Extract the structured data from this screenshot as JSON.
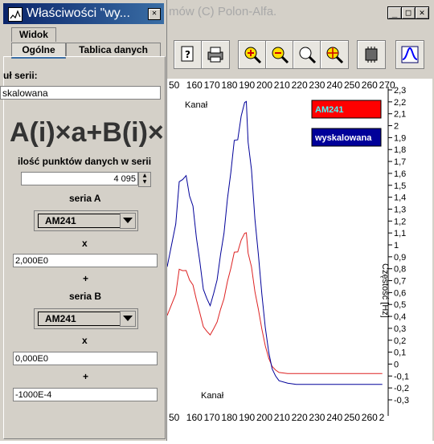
{
  "main_window": {
    "title_visible": "mów (C) Polon-Alfa.",
    "controls": [
      "_",
      "□",
      "✕"
    ],
    "toolbar_icons": [
      "document-help-icon",
      "printer-icon",
      "zoom-in-icon",
      "zoom-out-icon",
      "zoom-fit-icon",
      "pan-icon",
      "chip-icon",
      "chart-icon"
    ]
  },
  "chart_data": {
    "type": "line",
    "x_ticks_top": [
      "50",
      "160",
      "170",
      "180",
      "190",
      "200",
      "210",
      "220",
      "230",
      "240",
      "250",
      "260",
      "270"
    ],
    "x_ticks_bottom": [
      "50",
      "160",
      "170",
      "180",
      "190",
      "200",
      "210",
      "220",
      "230",
      "240",
      "250",
      "260",
      "2"
    ],
    "xlabel_top": "Kanał",
    "xlabel_bottom": "Kanał",
    "ylabel": "Częstość [Hz]",
    "y_ticks": [
      "2,3",
      "2,2",
      "2,1",
      "2",
      "1,9",
      "1,8",
      "1,7",
      "1,6",
      "1,5",
      "1,4",
      "1,3",
      "1,2",
      "1,1",
      "1",
      "0,9",
      "0,8",
      "0,7",
      "0,6",
      "0,5",
      "0,4",
      "0,3",
      "0,2",
      "0,1",
      "0",
      "-0,1",
      "-0,2",
      "-0,3"
    ],
    "ylim": [
      -0.3,
      2.3
    ],
    "xlim": [
      145,
      272
    ],
    "series": [
      {
        "name": "AM241",
        "color": "#dd2222",
        "x": [
          145,
          150,
          152,
          154,
          156,
          158,
          160,
          162,
          164,
          166,
          168,
          170,
          172,
          174,
          176,
          178,
          180,
          182,
          184,
          186,
          188,
          190,
          191,
          192,
          194,
          196,
          198,
          200,
          202,
          204,
          206,
          208,
          210,
          215,
          220,
          230,
          240,
          250,
          260,
          270
        ],
        "y": [
          0.4,
          0.6,
          0.78,
          0.8,
          0.77,
          0.72,
          0.65,
          0.55,
          0.42,
          0.32,
          0.27,
          0.25,
          0.29,
          0.36,
          0.45,
          0.56,
          0.68,
          0.82,
          0.92,
          0.96,
          1.02,
          1.12,
          1.08,
          0.95,
          0.8,
          0.62,
          0.45,
          0.3,
          0.15,
          0.05,
          -0.02,
          -0.05,
          -0.07,
          -0.08,
          -0.08,
          -0.08,
          -0.08,
          -0.08,
          -0.08,
          -0.08
        ]
      },
      {
        "name": "wyskalowana",
        "color": "#000099",
        "x": [
          145,
          150,
          152,
          154,
          156,
          158,
          160,
          162,
          164,
          166,
          168,
          170,
          172,
          174,
          176,
          178,
          180,
          182,
          184,
          186,
          188,
          190,
          191,
          192,
          194,
          196,
          198,
          200,
          202,
          204,
          206,
          208,
          210,
          215,
          220,
          230,
          240,
          250,
          260,
          270
        ],
        "y": [
          0.8,
          1.2,
          1.5,
          1.58,
          1.55,
          1.44,
          1.3,
          1.08,
          0.84,
          0.64,
          0.54,
          0.5,
          0.58,
          0.72,
          0.9,
          1.12,
          1.36,
          1.64,
          1.84,
          1.92,
          2.04,
          2.24,
          2.16,
          1.9,
          1.6,
          1.24,
          0.9,
          0.6,
          0.3,
          0.1,
          -0.04,
          -0.1,
          -0.14,
          -0.16,
          -0.17,
          -0.17,
          -0.17,
          -0.17,
          -0.17,
          -0.17
        ]
      }
    ]
  },
  "dialog": {
    "title": "Właściwości \"wy...",
    "close_label": "✕",
    "tabs": {
      "widok": "Widok",
      "ogolne": "Ogólne",
      "tablica": "Tablica danych"
    },
    "series_name_label": "uł serii:",
    "series_name_value": "skalowana",
    "formula": "A(i)×a+B(i)×",
    "points_label": "ilość punktów danych w serii",
    "points_value": "4 095",
    "seria_a_label": "seria A",
    "seria_a_value": "AM241",
    "x1_label": "x",
    "a_value": "2,000E0",
    "plus1_label": "+",
    "seria_b_label": "seria B",
    "seria_b_value": "AM241",
    "x2_label": "x",
    "b_value": "0,000E0",
    "plus2_label": "+",
    "c_value": "-1000E-4"
  }
}
